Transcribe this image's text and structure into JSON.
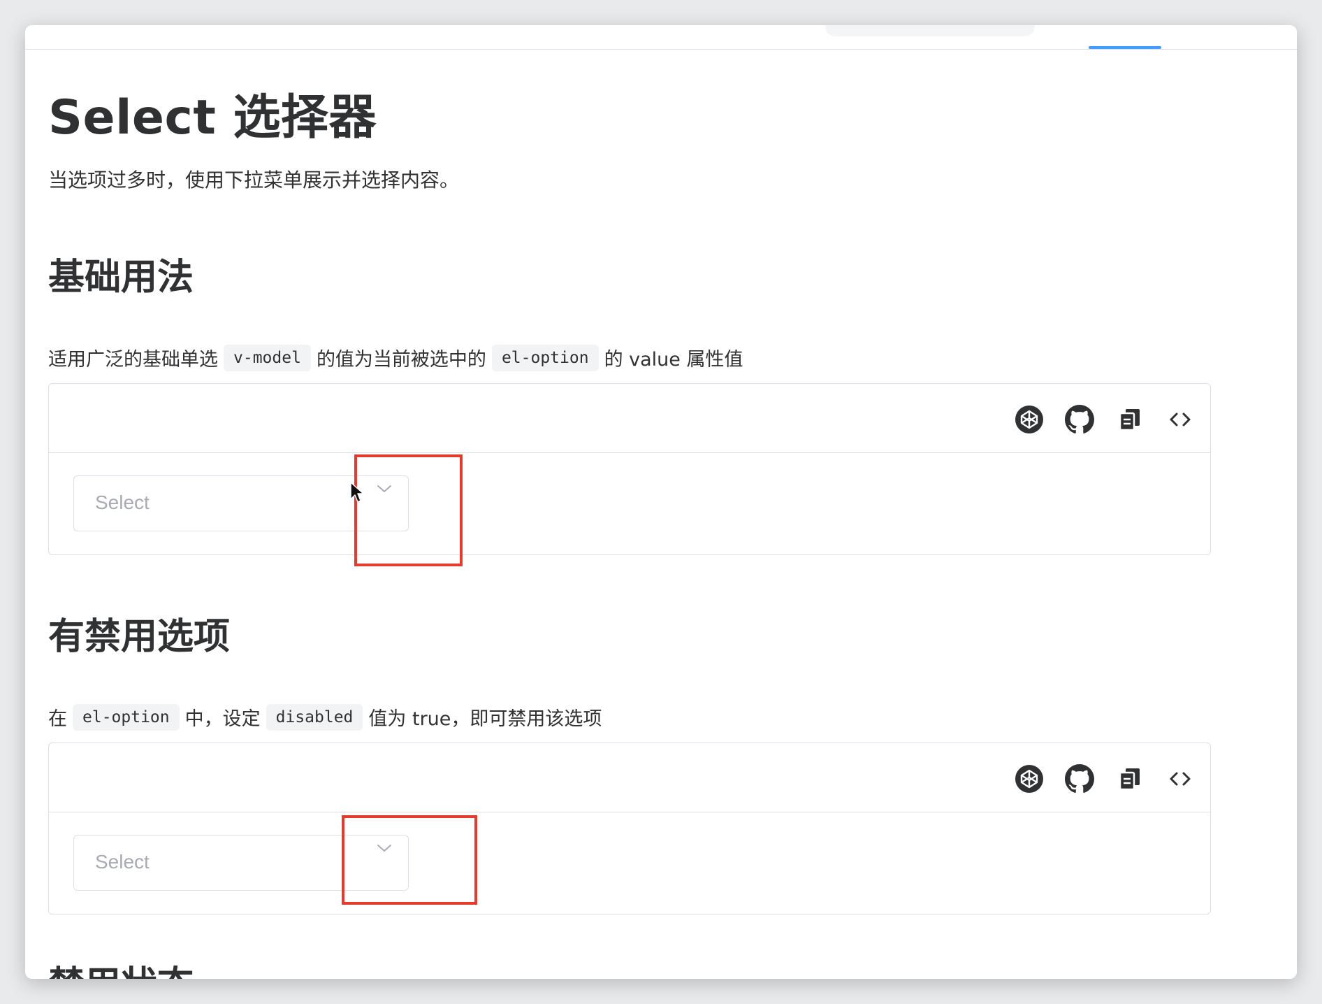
{
  "page": {
    "title": "Select 选择器",
    "description": "当选项过多时，使用下拉菜单展示并选择内容。"
  },
  "sections": [
    {
      "title": "基础用法",
      "desc_parts": [
        "适用广泛的基础单选",
        "v-model",
        "的值为当前被选中的",
        "el-option",
        "的 value 属性值"
      ],
      "select_placeholder": "Select"
    },
    {
      "title": "有禁用选项",
      "desc_parts": [
        "在",
        "el-option",
        "中，设定",
        "disabled",
        "值为 true，即可禁用该选项"
      ],
      "select_placeholder": "Select"
    },
    {
      "title": "禁用状态"
    }
  ],
  "toolbar_icons": [
    "codepen-icon",
    "github-icon",
    "copy-icon",
    "code-icon"
  ],
  "colors": {
    "accent": "#409eff",
    "highlight": "#e53a2e",
    "border": "#dcdfe6",
    "placeholder": "#a8abb2"
  }
}
